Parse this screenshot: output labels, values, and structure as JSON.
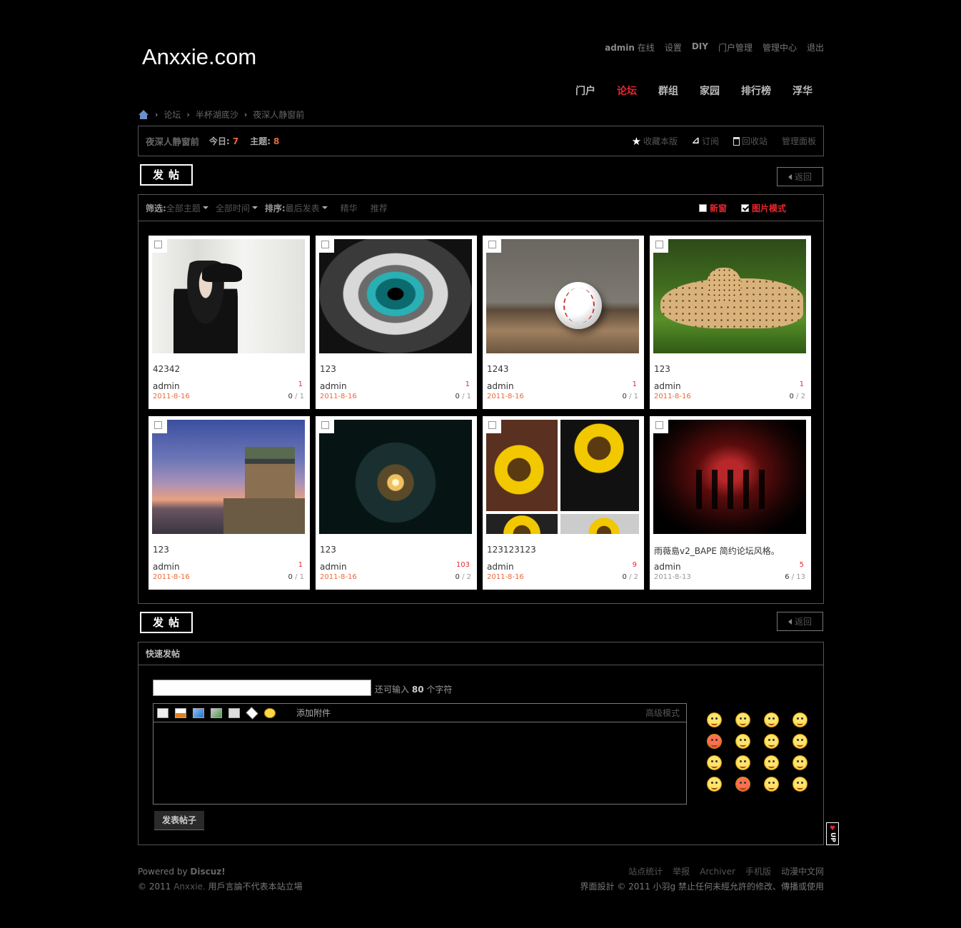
{
  "site": {
    "logo": "Anxxie.com"
  },
  "toplinks": {
    "user": "admin",
    "online": "在线",
    "settings": "设置",
    "diy": "DIY",
    "portal_admin": "门户管理",
    "admin_center": "管理中心",
    "logout": "退出"
  },
  "nav": [
    "门户",
    "论坛",
    "群组",
    "家园",
    "排行榜",
    "浮华"
  ],
  "breadcrumb": [
    "论坛",
    "半杯湖底沙",
    "夜深人静窗前"
  ],
  "forum": {
    "name": "夜深人静窗前",
    "today_label": "今日:",
    "today": "7",
    "threads_label": "主题:",
    "threads": "8",
    "favorite": "收藏本版",
    "subscribe": "订阅",
    "recycle": "回收站",
    "manage": "管理面板"
  },
  "buttons": {
    "post": "发帖",
    "back": "返回"
  },
  "filter": {
    "label": "筛选:",
    "topics": "全部主题",
    "time": "全部时间",
    "sort_label": "排序:",
    "sort": "最后发表",
    "digest": "精华",
    "recommend": "推荐",
    "new_window": "新窗",
    "picture_mode": "图片模式"
  },
  "threads": [
    {
      "title": "42342",
      "author": "admin",
      "date": "2011-8-16",
      "replies": "1",
      "views_a": "0",
      "views_b": "1"
    },
    {
      "title": "123",
      "author": "admin",
      "date": "2011-8-16",
      "replies": "1",
      "views_a": "0",
      "views_b": "1"
    },
    {
      "title": "1243",
      "author": "admin",
      "date": "2011-8-16",
      "replies": "1",
      "views_a": "0",
      "views_b": "1"
    },
    {
      "title": "123",
      "author": "admin",
      "date": "2011-8-16",
      "replies": "1",
      "views_a": "0",
      "views_b": "2"
    },
    {
      "title": "123",
      "author": "admin",
      "date": "2011-8-16",
      "replies": "1",
      "views_a": "0",
      "views_b": "1"
    },
    {
      "title": "123",
      "author": "admin",
      "date": "2011-8-16",
      "replies": "103",
      "views_a": "0",
      "views_b": "2"
    },
    {
      "title": "123123123",
      "author": "admin",
      "date": "2011-8-16",
      "replies": "9",
      "views_a": "0",
      "views_b": "2"
    },
    {
      "title": "雨薇島v2_BAPE 简约论坛风格。",
      "author": "admin",
      "date": "2011-8-13",
      "replies": "5",
      "views_a": "6",
      "views_b": "13"
    }
  ],
  "fastpost": {
    "title": "快速发帖",
    "remain_prefix": "还可输入",
    "remain_count": "80",
    "remain_suffix": "个字符",
    "attach": "添加附件",
    "advanced": "高级模式",
    "submit": "发表帖子"
  },
  "up_button": "UP",
  "footer": {
    "powered_prefix": "Powered by",
    "powered_name": "Discuz!",
    "copyright_prefix": "© 2011",
    "copyright_site": "Anxxie.",
    "copyright_suffix": "用戶言論不代表本站立場",
    "links": [
      "站点统计",
      "举报",
      "Archiver",
      "手机版",
      "动漫中文网"
    ],
    "design_prefix": "界面設計 © 2011",
    "design_name": "小羽g",
    "design_suffix": "禁止任何未經允許的修改、傳播或使用"
  },
  "colors": {
    "accent_red": "#e8262f",
    "accent_orange": "#e86a3a",
    "background": "#000000"
  }
}
